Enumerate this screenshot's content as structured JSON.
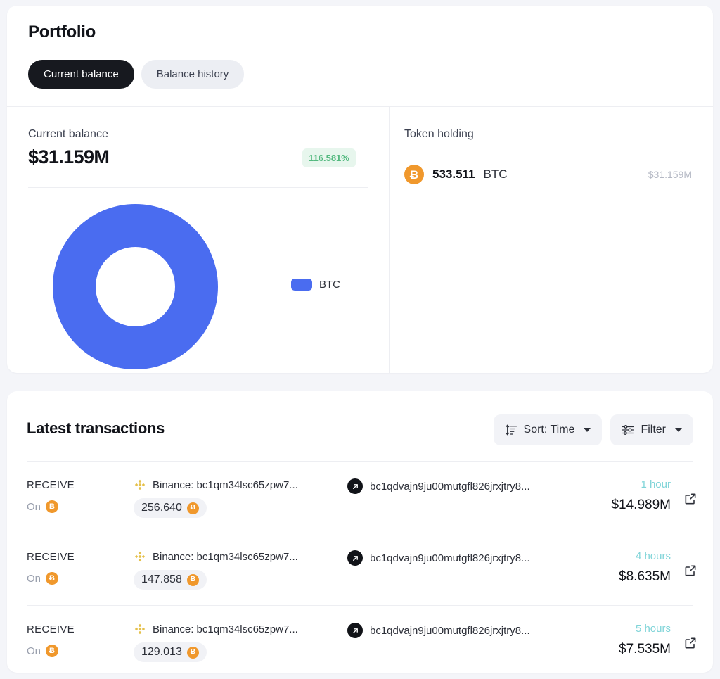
{
  "portfolio": {
    "title": "Portfolio",
    "tabs": [
      {
        "label": "Current balance",
        "active": true
      },
      {
        "label": "Balance history",
        "active": false
      }
    ],
    "balance": {
      "label": "Current balance",
      "value": "$31.159M",
      "change_badge": "116.581%"
    },
    "token_holding": {
      "label": "Token holding",
      "amount": "533.511",
      "symbol": "BTC",
      "usd_value": "$31.159M",
      "coin_icon": "bitcoin-icon"
    }
  },
  "chart_data": {
    "type": "pie",
    "title": "",
    "categories": [
      "BTC"
    ],
    "values": [
      100
    ],
    "labels": [
      "BTC"
    ],
    "colors": [
      "#4a6cf0"
    ],
    "donut": true,
    "inner_radius_ratio": 0.54,
    "legend": {
      "position": "right",
      "entries": [
        {
          "label": "BTC",
          "color": "#4a6cf0"
        }
      ]
    }
  },
  "transactions": {
    "title": "Latest transactions",
    "controls": {
      "sort": {
        "label": "Sort: Time",
        "icon": "sort-icon"
      },
      "filter": {
        "label": "Filter",
        "icon": "filter-sliders-icon"
      }
    },
    "rows": [
      {
        "type": "RECEIVE",
        "on_label": "On",
        "chain_icon": "bitcoin-icon",
        "from_icon": "binance-icon",
        "from": "Binance: bc1qm34lsc65zpw7...",
        "amount": "256.640",
        "amount_icon": "bitcoin-icon",
        "to_icon": "arrow-up-right-badge-icon",
        "to": "bc1qdvajn9ju00mutgfl826jrxjtry8...",
        "time": "1 hour",
        "value": "$14.989M",
        "link_icon": "external-link-icon"
      },
      {
        "type": "RECEIVE",
        "on_label": "On",
        "chain_icon": "bitcoin-icon",
        "from_icon": "binance-icon",
        "from": "Binance: bc1qm34lsc65zpw7...",
        "amount": "147.858",
        "amount_icon": "bitcoin-icon",
        "to_icon": "arrow-up-right-badge-icon",
        "to": "bc1qdvajn9ju00mutgfl826jrxjtry8...",
        "time": "4 hours",
        "value": "$8.635M",
        "link_icon": "external-link-icon"
      },
      {
        "type": "RECEIVE",
        "on_label": "On",
        "chain_icon": "bitcoin-icon",
        "from_icon": "binance-icon",
        "from": "Binance: bc1qm34lsc65zpw7...",
        "amount": "129.013",
        "amount_icon": "bitcoin-icon",
        "to_icon": "arrow-up-right-badge-icon",
        "to": "bc1qdvajn9ju00mutgfl826jrxjtry8...",
        "time": "5 hours",
        "value": "$7.535M",
        "link_icon": "external-link-icon"
      }
    ]
  },
  "colors": {
    "accent": "#4a6cf0",
    "bitcoin": "#f0982c",
    "binance": "#e5c04a",
    "positive": "#53b97f",
    "positive_bg": "#e7f6ed",
    "time": "#7fd4d8",
    "page_bg": "#f4f5f9"
  },
  "symbols": {
    "bitcoin_glyph": "Ƀ"
  }
}
